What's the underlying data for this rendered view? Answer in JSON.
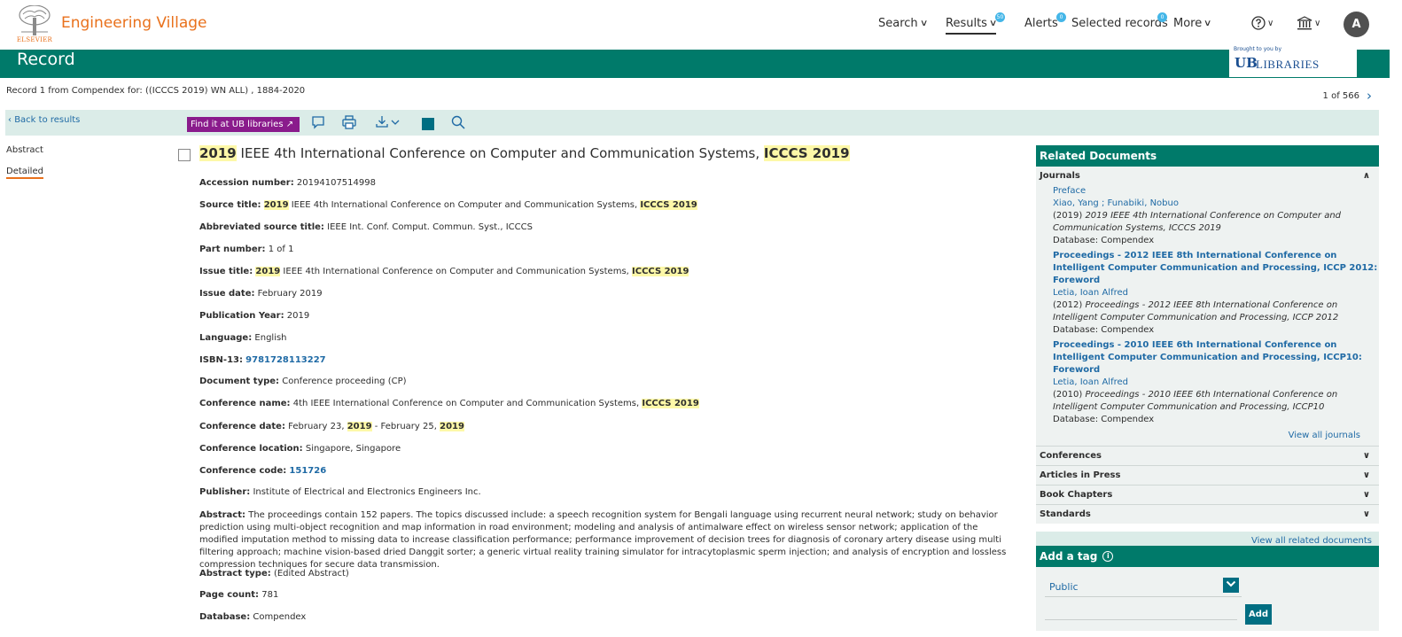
{
  "header": {
    "brand": "Engineering Village",
    "logo_text": "ELSEVIER",
    "nav": {
      "search": "Search",
      "results": "Results",
      "results_badge": "50",
      "alerts": "Alerts",
      "alerts_badge": "0",
      "selected": "Selected records",
      "selected_badge": "0",
      "more": "More"
    },
    "avatar": "A"
  },
  "record_band": {
    "title": "Record",
    "brought_by": "Brought to you by",
    "ub": "UB",
    "libraries": "LIBRARIES"
  },
  "subline": "Record 1 from Compendex for: ((ICCCS 2019) WN ALL) , 1884-2020",
  "pager": "1 of 566",
  "toolbar": {
    "back": "Back to results",
    "findit": "Find it at UB libraries"
  },
  "leftnav": {
    "abstract": "Abstract",
    "detailed": "Detailed"
  },
  "doc": {
    "title_hl1": "2019",
    "title_mid": " IEEE 4th International Conference on Computer and Communication Systems, ",
    "title_hl2": "ICCCS 2019",
    "fields": {
      "accession_label": "Accession number:",
      "accession": "20194107514998",
      "source_label": "Source title:",
      "source_hl1": "2019",
      "source_mid": " IEEE 4th International Conference on Computer and Communication Systems, ",
      "source_hl2": "ICCCS 2019",
      "abbrev_label": "Abbreviated source title:",
      "abbrev": "IEEE Int. Conf. Comput. Commun. Syst., ICCCS",
      "part_label": "Part number:",
      "part": "1 of 1",
      "issue_label": "Issue title:",
      "issue_hl1": "2019",
      "issue_mid": " IEEE 4th International Conference on Computer and Communication Systems, ",
      "issue_hl2": "ICCCS 2019",
      "issuedate_label": "Issue date:",
      "issuedate": "February 2019",
      "pubyear_label": "Publication Year:",
      "pubyear": "2019",
      "lang_label": "Language:",
      "lang": "English",
      "isbn_label": "ISBN-13:",
      "isbn": "9781728113227",
      "doctype_label": "Document type:",
      "doctype": "Conference proceeding (CP)",
      "confname_label": "Conference name:",
      "confname": "4th IEEE International Conference on Computer and Communication Systems, ",
      "confname_hl": "ICCCS 2019",
      "confdate_label": "Conference date:",
      "confdate_a": "February 23, ",
      "confdate_hl1": "2019",
      "confdate_b": " - February 25, ",
      "confdate_hl2": "2019",
      "confloc_label": "Conference location:",
      "confloc": "Singapore, Singapore",
      "confcode_label": "Conference code:",
      "confcode": "151726",
      "publisher_label": "Publisher:",
      "publisher": "Institute of Electrical and Electronics Engineers Inc.",
      "abstract_label": "Abstract:",
      "abstract": "The proceedings contain 152 papers. The topics discussed include: a speech recognition system for Bengali language using recurrent neural network; study on behavior prediction using multi-object recognition and map information in road environment; modeling and analysis of antimalware effect on wireless sensor network; application of the modified imputation method to missing data to increase classification performance; performance improvement of decision trees for diagnosis of coronary artery disease using multi filtering approach; machine vision-based dried Danggit sorter; a generic virtual reality training simulator for intracytoplasmic sperm injection; and analysis of encryption and lossless compression techniques for secure data transmission.",
      "abstype_label": "Abstract type:",
      "abstype": "(Edited Abstract)",
      "pagecount_label": "Page count:",
      "pagecount": "781",
      "database_label": "Database:",
      "database": "Compendex"
    }
  },
  "related": {
    "header": "Related Documents",
    "journals": "Journals",
    "items": [
      {
        "title": "Preface",
        "authors": "Xiao, Yang ; Funabiki, Nobuo",
        "year": "(2019) ",
        "source": "2019 IEEE 4th International Conference on Computer and Communication Systems, ICCCS 2019",
        "db": "Database: Compendex"
      },
      {
        "title": "Proceedings - 2012 IEEE 8th International Conference on Intelligent Computer Communication and Processing, ICCP 2012: Foreword",
        "authors": "Letia, Ioan Alfred",
        "year": "(2012) ",
        "source": "Proceedings - 2012 IEEE 8th International Conference on Intelligent Computer Communication and Processing, ICCP 2012",
        "db": "Database: Compendex"
      },
      {
        "title": "Proceedings - 2010 IEEE 6th International Conference on Intelligent Computer Communication and Processing, ICCP10: Foreword",
        "authors": "Letia, Ioan Alfred",
        "year": "(2010) ",
        "source": "Proceedings - 2010 IEEE 6th International Conference on Intelligent Computer Communication and Processing, ICCP10",
        "db": "Database: Compendex"
      }
    ],
    "view_all_journals": "View all journals",
    "sections": [
      "Conferences",
      "Articles in Press",
      "Book Chapters",
      "Standards"
    ],
    "view_all_related": "View all related documents"
  },
  "tag": {
    "header": "Add a tag",
    "info": "i",
    "select_value": "Public",
    "add": "Add"
  },
  "colors": {
    "brand_orange": "#e9711c",
    "teal": "#007a6a",
    "link_blue": "#1f6aa5",
    "highlight": "#fdf8a8",
    "findit_purple": "#8a1b8c"
  }
}
